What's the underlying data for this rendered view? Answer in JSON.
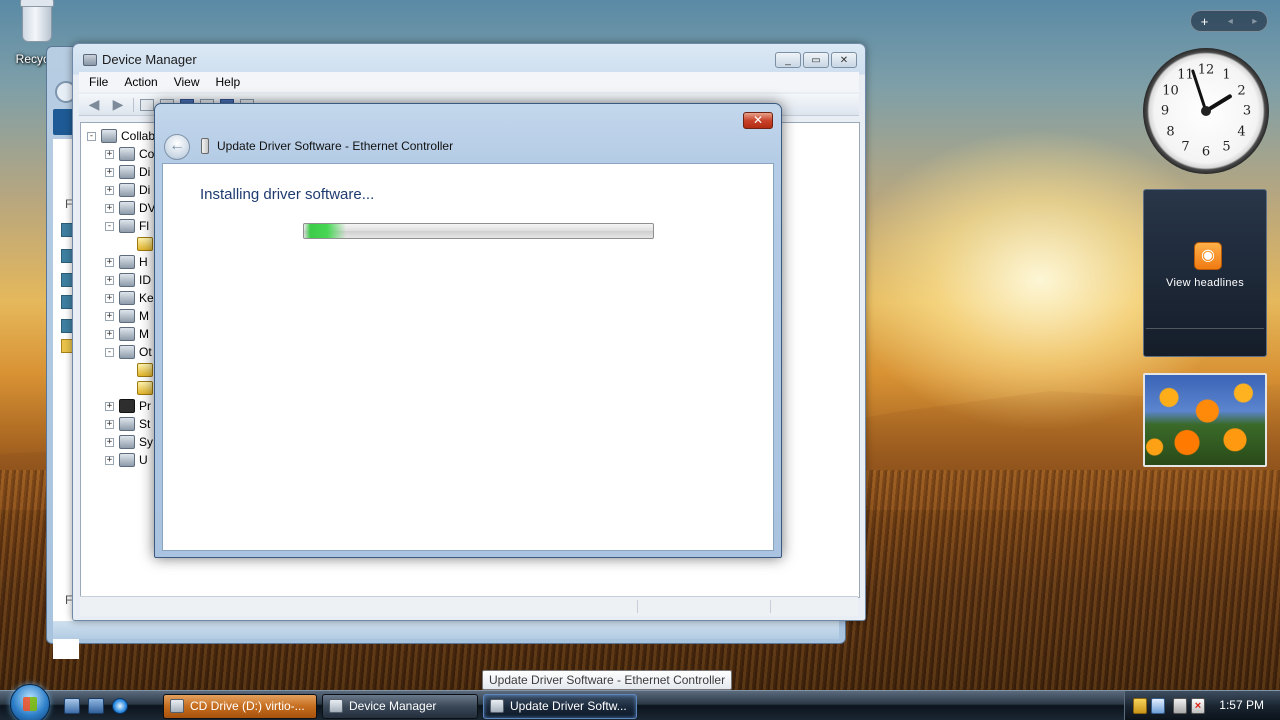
{
  "desktop": {
    "icon_label": "Recycle"
  },
  "back_window": {
    "side_letters": [
      "F",
      "F"
    ]
  },
  "device_manager": {
    "title": "Device Manager",
    "menu": [
      "File",
      "Action",
      "View",
      "Help"
    ],
    "caption_buttons": [
      "_",
      "▭",
      "✕"
    ],
    "tree": {
      "root": "Collab",
      "nodes": [
        "Co",
        "Di",
        "Di",
        "DV",
        "Fl",
        "",
        "H",
        "ID",
        "Ke",
        "M",
        "M",
        "Ot",
        "",
        "",
        "Pr",
        "St",
        "Sy",
        "U"
      ]
    }
  },
  "dialog": {
    "title": "Update Driver Software - Ethernet Controller",
    "close_label": "✕",
    "back_arrow": "←",
    "status_text": "Installing driver software...",
    "progress_fraction": 0.12
  },
  "gadgets": {
    "control_plus": "+",
    "control_prev": "◂",
    "control_next": "▸",
    "clock": {
      "numbers": [
        "12",
        "1",
        "2",
        "3",
        "4",
        "5",
        "6",
        "7",
        "8",
        "9",
        "10",
        "11"
      ],
      "hour": 1,
      "minute": 57
    },
    "feed_symbol": "◉",
    "feed_label": "View headlines"
  },
  "tooltip": "Update Driver Software - Ethernet Controller",
  "taskbar": {
    "buttons": [
      "CD Drive (D:) virtio-...",
      "Device Manager",
      "Update Driver Softw..."
    ],
    "time": "1:57 PM"
  },
  "colors": {
    "progress_green": "#3ccc48",
    "heading_blue": "#1e3b70",
    "active_task_orange": "#c56d1f"
  }
}
